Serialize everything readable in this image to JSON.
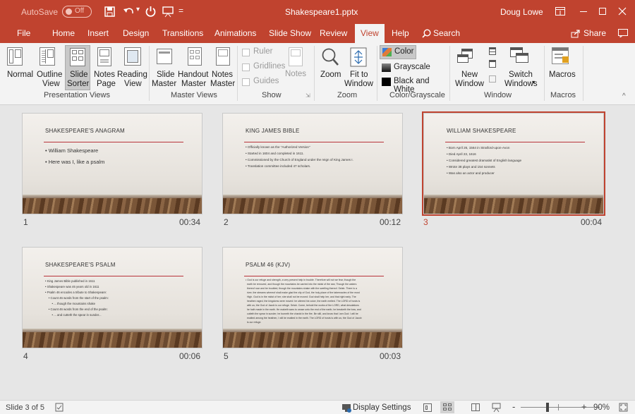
{
  "titlebar": {
    "autosave_label": "AutoSave",
    "autosave_state": "Off",
    "filename": "Shakespeare1.pptx",
    "user": "Doug Lowe"
  },
  "tabs": [
    "File",
    "Home",
    "Insert",
    "Design",
    "Transitions",
    "Animations",
    "Slide Show",
    "Review",
    "View",
    "Help"
  ],
  "active_tab": "View",
  "search_label": "Search",
  "share_label": "Share",
  "ribbon": {
    "presentation_views": {
      "label": "Presentation Views",
      "buttons": [
        {
          "l1": "Normal",
          "l2": ""
        },
        {
          "l1": "Outline",
          "l2": "View"
        },
        {
          "l1": "Slide",
          "l2": "Sorter"
        },
        {
          "l1": "Notes",
          "l2": "Page"
        },
        {
          "l1": "Reading",
          "l2": "View"
        }
      ]
    },
    "master_views": {
      "label": "Master Views",
      "buttons": [
        {
          "l1": "Slide",
          "l2": "Master"
        },
        {
          "l1": "Handout",
          "l2": "Master"
        },
        {
          "l1": "Notes",
          "l2": "Master"
        }
      ]
    },
    "show": {
      "label": "Show",
      "checks": [
        "Ruler",
        "Gridlines",
        "Guides"
      ],
      "notes": "Notes"
    },
    "zoom": {
      "label": "Zoom",
      "zoom_btn": "Zoom",
      "fit_l1": "Fit to",
      "fit_l2": "Window"
    },
    "color": {
      "label": "Color/Grayscale",
      "items": [
        "Color",
        "Grayscale",
        "Black and White"
      ]
    },
    "window": {
      "label": "Window",
      "new_l1": "New",
      "new_l2": "Window",
      "switch_l1": "Switch",
      "switch_l2": "Windows"
    },
    "macros": {
      "label": "Macros",
      "btn": "Macros"
    }
  },
  "slides": [
    {
      "number": "1",
      "duration": "00:34",
      "title": "SHAKESPEARE'S ANAGRAM",
      "bullets": [
        "• William Shakespeare",
        "• Here was I, like a psalm"
      ]
    },
    {
      "number": "2",
      "duration": "00:12",
      "title": "KING JAMES BIBLE",
      "bullets": [
        "• Officially known as the \"Authorized Version\"",
        "• Started in 1604 and completed in 1611.",
        "• Commissioned by the Church of England under the reign of King James I.",
        "• Translation committee included 47 scholars."
      ]
    },
    {
      "number": "3",
      "duration": "00:04",
      "title": "WILLIAM SHAKESPEARE",
      "bullets": [
        "• Born April 26, 1564 in Stratford-upon-Avon",
        "• Died April 23, 1616",
        "• Considered greatest dramatist of English language",
        "• Wrote 38 plays and 154 sonnets",
        "• Was also an actor and producer"
      ]
    },
    {
      "number": "4",
      "duration": "00:06",
      "title": "SHAKESPEARE'S PSALM",
      "bullets": [
        "• King James Bible published in 1611",
        "• Shakespeare was 46 years old in 1611",
        "• Psalm 46 encodes a tribute to Shakespeare:",
        "    • Count 46 words from the start of the psalm:",
        "        • ... though the mountains shake",
        "    • Count 46 words from the end of the psalm:",
        "        • ... and cutteth the spear in sunder..."
      ]
    },
    {
      "number": "5",
      "duration": "00:03",
      "title": "PSALM 46 (KJV)",
      "bullets": [
        "• God is our refuge and strength, a very present help in trouble. Therefore will not we fear, though the",
        "  earth be removed, and though the mountains be carried into the midst of the sea; Though the waters",
        "  thereof roar and be troubled, though the mountains shake with the swelling thereof. Selah. There is a",
        "  river, the streams whereof shall make glad the city of God, the holy place of the tabernacles of the most",
        "  High. God is in the midst of her; she shall not be moved: God shall help her, and that right early. The",
        "  heathen raged, the kingdoms were moved: he uttered his voice, the earth melted. The LORD of hosts is",
        "  with us; the God of Jacob is our refuge. Selah. Come, behold the works of the LORD, what desolations",
        "  he hath made in the earth. He maketh wars to cease unto the end of the earth; he breaketh the bow, and",
        "  cutteth the spear in sunder; he burneth the chariot in the fire. Be still, and know that I am God: I will be",
        "  exalted among the heathen, I will be exalted in the earth. The LORD of hosts is with us; the God of Jacob",
        "  is our refuge."
      ]
    }
  ],
  "selected_slide": "3",
  "status": {
    "slide_of": "Slide 3 of 5",
    "display_settings": "Display Settings",
    "zoom_pct": "90%"
  }
}
